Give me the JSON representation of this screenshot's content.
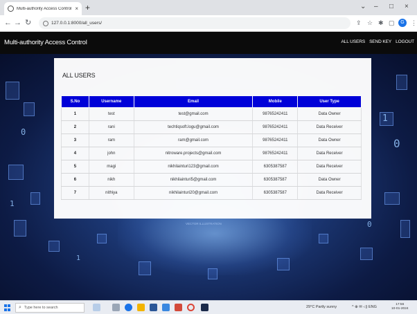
{
  "browser": {
    "tab_title": "Multi-authority Access Control",
    "tab_close": "×",
    "new_tab": "+",
    "url": "127.0.0.1:8000/all_users/",
    "window_controls": [
      "⌄",
      "–",
      "□",
      "×"
    ],
    "profile_initial": "G"
  },
  "site": {
    "brand": "Multi-authority Access Control",
    "nav": [
      "ALL USERS",
      "SEND KEY",
      "LOGOUT"
    ]
  },
  "card": {
    "title": "ALL USERS"
  },
  "table": {
    "headers": [
      "S.No",
      "Username",
      "Email",
      "Mobile",
      "User Type"
    ],
    "rows": [
      [
        "1",
        "test",
        "test@gmail.com",
        "98765242411",
        "Data Owner"
      ],
      [
        "2",
        "rani",
        "techtiqsoft.logu@gmail.com",
        "98765242411",
        "Data Receiver"
      ],
      [
        "3",
        "ram",
        "ram@gmail.com",
        "98765242411",
        "Data Owner"
      ],
      [
        "4",
        "john",
        "nitroware.projects@gmail.com",
        "98765242411",
        "Data Receiver"
      ],
      [
        "5",
        "magi",
        "nikhilainturi123@gmail.com",
        "6305387587",
        "Data Receiver"
      ],
      [
        "6",
        "nikh",
        "nikhilainturi5@gmail.com",
        "6305387587",
        "Data Owner"
      ],
      [
        "7",
        "nithiya",
        "nikhilainturi20@gmail.com",
        "6305387587",
        "Data Receiver"
      ]
    ],
    "header_color": "#0000dd"
  },
  "background": {
    "caption": "VECTOR ILLUSTRATION",
    "digits": [
      "0",
      "1",
      "0",
      "1",
      "0",
      "1"
    ]
  },
  "taskbar": {
    "search_placeholder": "Type here to search",
    "weather": "29°C  Partly sunny",
    "tray": "^  ⊕  ✉  ◁)  ENG",
    "time": "17:56",
    "date": "10-01-2024"
  }
}
